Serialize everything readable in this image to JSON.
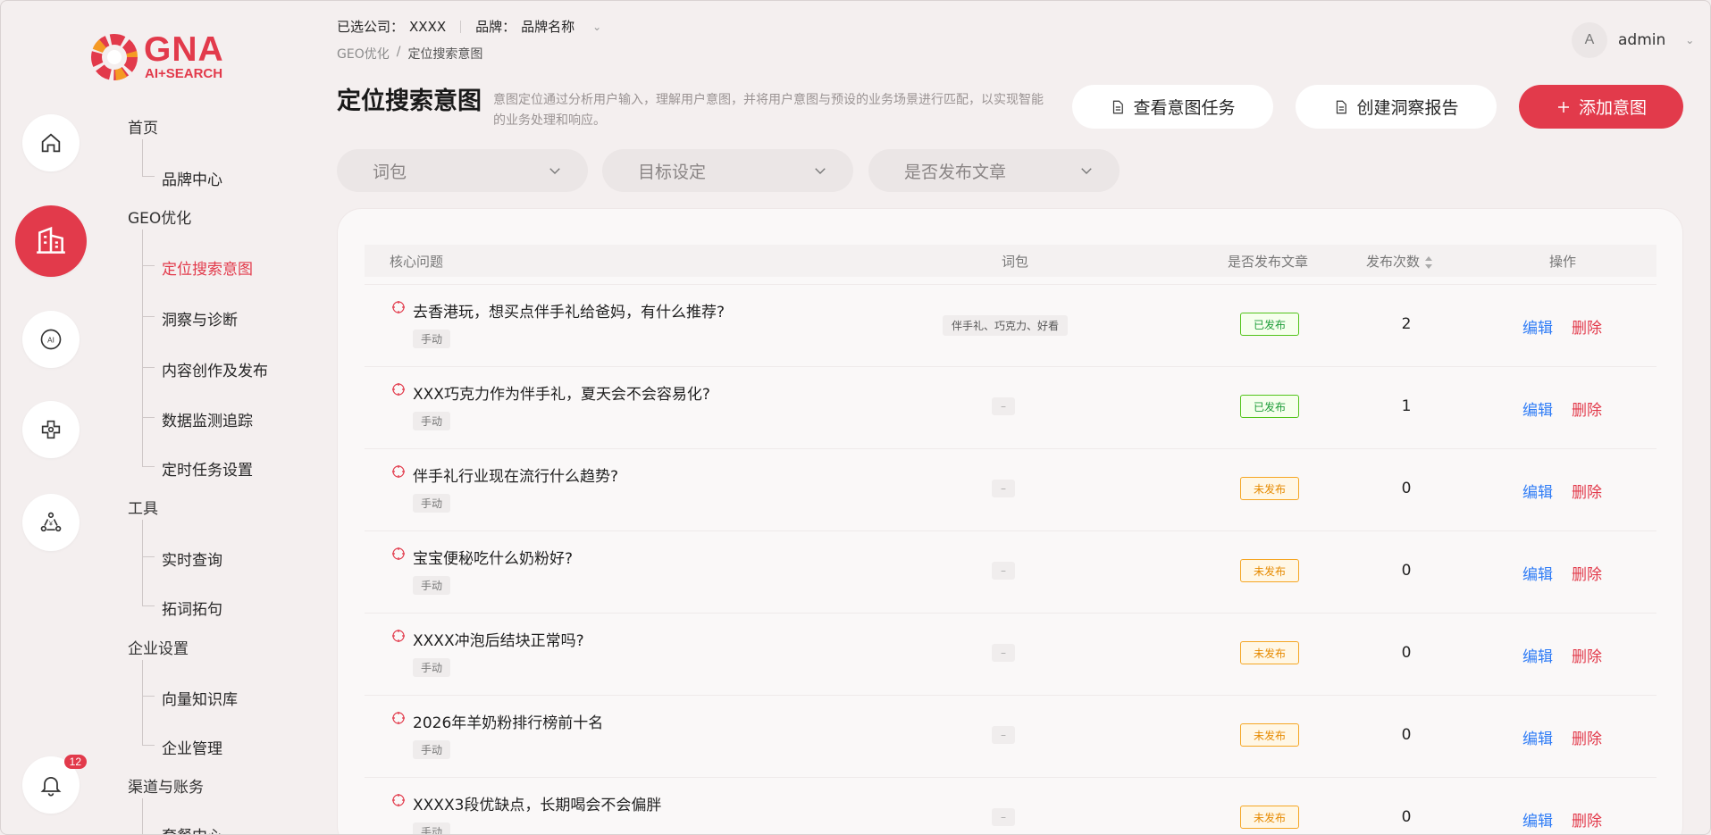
{
  "brand": {
    "logo_text": "GNA",
    "logo_sub": "AI+SEARCH"
  },
  "header": {
    "company_label": "已选公司：",
    "company_value": "XXXX",
    "brand_label": "品牌：",
    "brand_value": "品牌名称",
    "breadcrumb": [
      "GEO优化",
      "定位搜索意图"
    ],
    "breadcrumb_sep": "/",
    "user_avatar": "A",
    "user_name": "admin"
  },
  "rail": {
    "notification_count": "12",
    "icons": [
      "home-icon",
      "building-icon",
      "ai-icon",
      "network-icon",
      "money-flow-icon",
      "bell-icon"
    ]
  },
  "sidebar": {
    "groups": [
      {
        "label": "首页",
        "items": [
          "品牌中心"
        ]
      },
      {
        "label": "GEO优化",
        "items": [
          "定位搜索意图",
          "洞察与诊断",
          "内容创作及发布",
          "数据监测追踪",
          "定时任务设置"
        ]
      },
      {
        "label": "工具",
        "items": [
          "实时查询",
          "拓词拓句"
        ]
      },
      {
        "label": "企业设置",
        "items": [
          "向量知识库",
          "企业管理"
        ]
      },
      {
        "label": "渠道与账务",
        "items": [
          "套餐中心"
        ]
      }
    ]
  },
  "page": {
    "title": "定位搜索意图",
    "description": "意图定位通过分析用户输入，理解用户意图，并将用户意图与预设的业务场景进行匹配，以实现智能的业务处理和响应。",
    "btn_view_tasks": "查看意图任务",
    "btn_create_report": "创建洞察报告",
    "btn_add_intent": "添加意图"
  },
  "filters": {
    "keyword_pack": "词包",
    "target": "目标设定",
    "published": "是否发布文章"
  },
  "table": {
    "headers": {
      "question": "核心问题",
      "keywords": "词包",
      "published": "是否发布文章",
      "count": "发布次数",
      "actions": "操作"
    },
    "edit_label": "编辑",
    "delete_label": "删除",
    "rows": [
      {
        "question": "去香港玩，想买点伴手礼给爸妈，有什么推荐?",
        "tag": "手动",
        "keywords": "伴手礼、巧克力、好看",
        "status": "已发布",
        "status_type": "pub",
        "count": "2"
      },
      {
        "question": "XXX巧克力作为伴手礼，夏天会不会容易化?",
        "tag": "手动",
        "keywords": "–",
        "status": "已发布",
        "status_type": "pub",
        "count": "1"
      },
      {
        "question": "伴手礼行业现在流行什么趋势?",
        "tag": "手动",
        "keywords": "–",
        "status": "未发布",
        "status_type": "unpub",
        "count": "0"
      },
      {
        "question": "宝宝便秘吃什么奶粉好?",
        "tag": "手动",
        "keywords": "–",
        "status": "未发布",
        "status_type": "unpub",
        "count": "0"
      },
      {
        "question": "XXXX冲泡后结块正常吗?",
        "tag": "手动",
        "keywords": "–",
        "status": "未发布",
        "status_type": "unpub",
        "count": "0"
      },
      {
        "question": "2026年羊奶粉排行榜前十名",
        "tag": "手动",
        "keywords": "–",
        "status": "未发布",
        "status_type": "unpub",
        "count": "0"
      },
      {
        "question": "XXXX3段优缺点，长期喝会不会偏胖",
        "tag": "手动",
        "keywords": "–",
        "status": "未发布",
        "status_type": "unpub",
        "count": "0"
      }
    ]
  },
  "colors": {
    "accent": "#e23a4b",
    "link": "#2f7cf6",
    "published": "#52c41a",
    "unpublished": "#f5a623"
  }
}
